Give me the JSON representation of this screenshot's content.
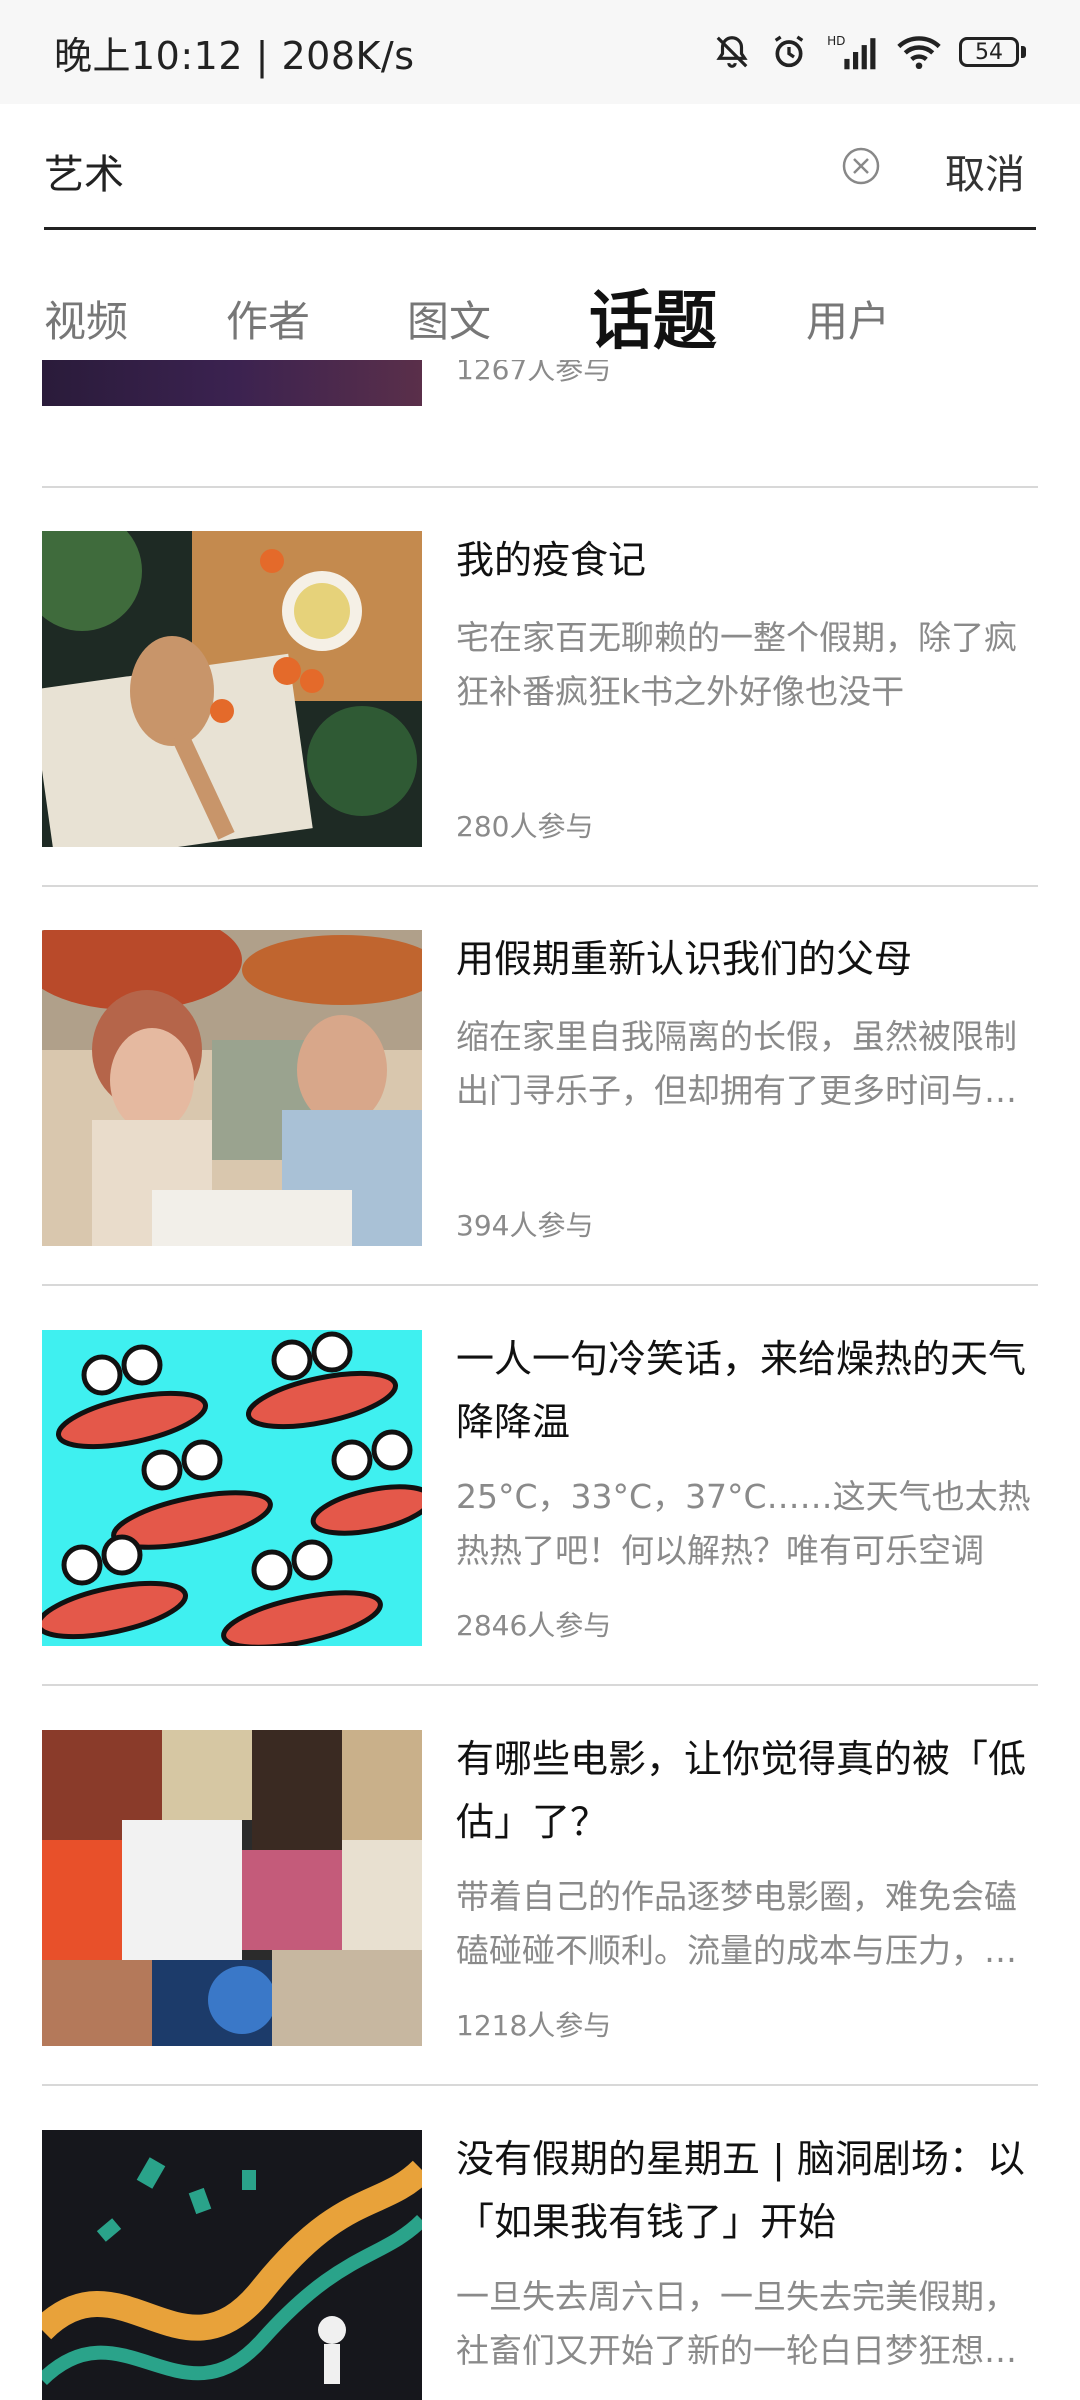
{
  "status_bar": {
    "time_speed": "晚上10:12 | 208K/s",
    "battery": "54",
    "icons": [
      "bell-muted-icon",
      "alarm-icon",
      "hd-signal-icon",
      "wifi-icon",
      "battery-icon"
    ]
  },
  "search": {
    "query": "艺术",
    "cancel_label": "取消"
  },
  "tabs": [
    {
      "label": "视频"
    },
    {
      "label": "作者"
    },
    {
      "label": "图文"
    },
    {
      "label": "话题",
      "active": true
    },
    {
      "label": "用户"
    }
  ],
  "topics": [
    {
      "count": "1267人参与"
    },
    {
      "title": "我的疫食记",
      "desc": "宅在家百无聊赖的一整个假期，除了疯狂补番疯狂k书之外好像也没干什………",
      "count": "280人参与"
    },
    {
      "title": "用假期重新认识我们的父母",
      "desc": "缩在家里自我隔离的长假，虽然被限制出门寻乐子，但却拥有了更多时间与…",
      "count": "394人参与"
    },
    {
      "title": "一人一句冷笑话，来给燥热的天气降降温",
      "desc": "25°C，33°C，37°C……这天气也太热热热了吧！何以解热？唯有可乐空调冰…",
      "count": "2846人参与"
    },
    {
      "title": "有哪些电影，让你觉得真的被「低估」了？",
      "desc": "带着自己的作品逐梦电影圈，难免会磕磕碰碰不顺利。流量的成本与压力，…",
      "count": "1218人参与"
    },
    {
      "title": "没有假期的星期五 | 脑洞剧场：以「如果我有钱了」开始",
      "desc": "一旦失去周六日，一旦失去完美假期，社畜们又开始了新的一轮白日梦狂想…"
    }
  ]
}
